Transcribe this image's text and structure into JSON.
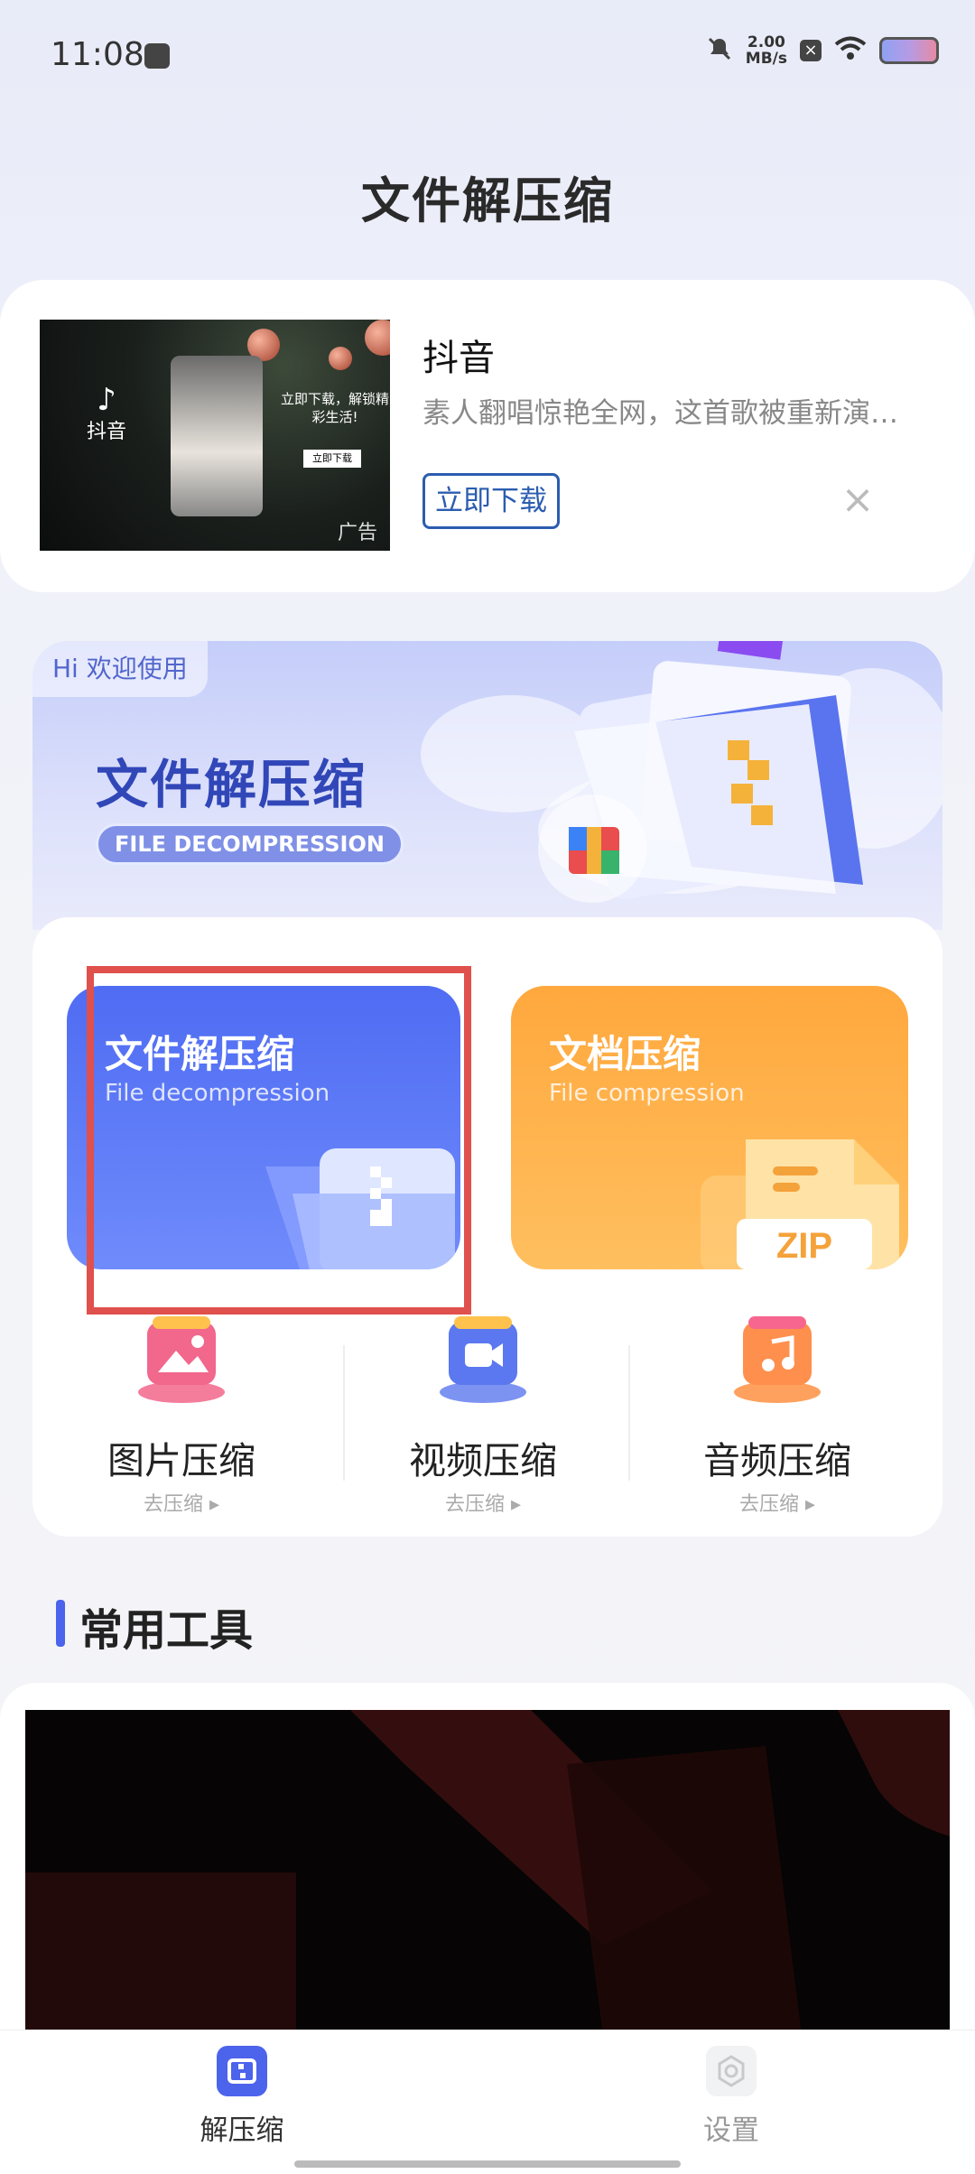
{
  "status_bar": {
    "time": "11:08",
    "net_speed_top": "2.00",
    "net_speed_bottom": "MB/s"
  },
  "page": {
    "title": "文件解压缩"
  },
  "ad": {
    "app_name": "抖音",
    "description": "素人翻唱惊艳全网，这首歌被重新演…",
    "download_label": "立即下载",
    "thumb_logo_text": "抖音",
    "thumb_promo": "立即下载，解锁精彩生活!",
    "thumb_button": "立即下载",
    "thumb_ad_tag": "广告"
  },
  "banner": {
    "hi_tag": "Hi  欢迎使用",
    "title": "文件解压缩",
    "subtitle": "FILE DECOMPRESSION"
  },
  "cards": {
    "decompress": {
      "title": "文件解压缩",
      "subtitle": "File decompression"
    },
    "compress": {
      "title": "文档压缩",
      "subtitle": "File compression",
      "zip_text": "ZIP"
    }
  },
  "mini_tools": [
    {
      "label": "图片压缩",
      "sub": "去压缩 ▸",
      "icon": "image-icon",
      "color": "#f2678c"
    },
    {
      "label": "视频压缩",
      "sub": "去压缩 ▸",
      "icon": "video-icon",
      "color": "#5b78f0"
    },
    {
      "label": "音频压缩",
      "sub": "去压缩 ▸",
      "icon": "music-icon",
      "color": "#ff8f4d"
    }
  ],
  "section": {
    "title": "常用工具"
  },
  "tabs": [
    {
      "label": "解压缩",
      "active": true,
      "icon": "unzip-icon"
    },
    {
      "label": "设置",
      "active": false,
      "icon": "settings-icon"
    }
  ],
  "colors": {
    "accent": "#4c63ec",
    "orange": "#ffa83d",
    "highlight": "#e0504c"
  }
}
